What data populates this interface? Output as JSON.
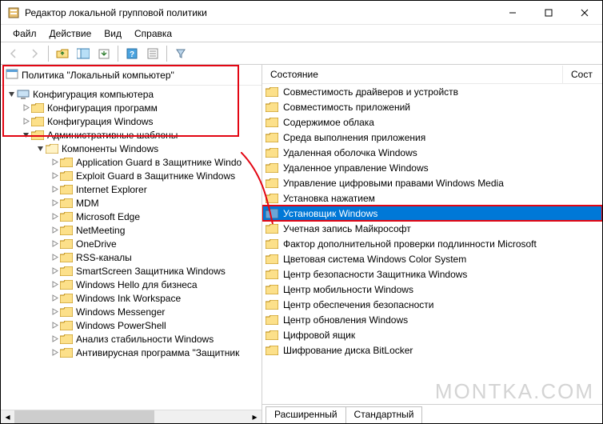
{
  "window": {
    "title": "Редактор локальной групповой политики"
  },
  "menu": {
    "file": "Файл",
    "action": "Действие",
    "view": "Вид",
    "help": "Справка"
  },
  "left": {
    "root": "Политика \"Локальный компьютер\"",
    "config_computer": "Конфигурация компьютера",
    "config_programs": "Конфигурация программ",
    "config_windows": "Конфигурация Windows",
    "admin_templates": "Административные шаблоны",
    "components": "Компоненты Windows",
    "sub": [
      "Application Guard в Защитнике Windo",
      "Exploit Guard в Защитнике Windows",
      "Internet Explorer",
      "MDM",
      "Microsoft Edge",
      "NetMeeting",
      "OneDrive",
      "RSS-каналы",
      "SmartScreen Защитника Windows",
      "Windows Hello для бизнеса",
      "Windows Ink Workspace",
      "Windows Messenger",
      "Windows PowerShell",
      "Анализ стабильности Windows",
      "Антивирусная программа \"Защитник"
    ]
  },
  "right": {
    "col1": "Состояние",
    "col2": "Сост",
    "items": [
      "Совместимость драйверов и устройств",
      "Совместимость приложений",
      "Содержимое облака",
      "Среда выполнения приложения",
      "Удаленная оболочка Windows",
      "Удаленное управление Windows",
      "Управление цифровыми правами Windows Media",
      "Установка нажатием",
      "Установщик Windows",
      "Учетная запись Майкрософт",
      "Фактор дополнительной проверки подлинности Microsoft",
      "Цветовая система Windows Color System",
      "Центр безопасности Защитника Windows",
      "Центр мобильности Windows",
      "Центр обеспечения безопасности",
      "Центр обновления Windows",
      "Цифровой ящик",
      "Шифрование диска BitLocker"
    ],
    "selected_index": 8,
    "tabs": {
      "extended": "Расширенный",
      "standard": "Стандартный"
    }
  },
  "watermark": "MONTKA.COM"
}
